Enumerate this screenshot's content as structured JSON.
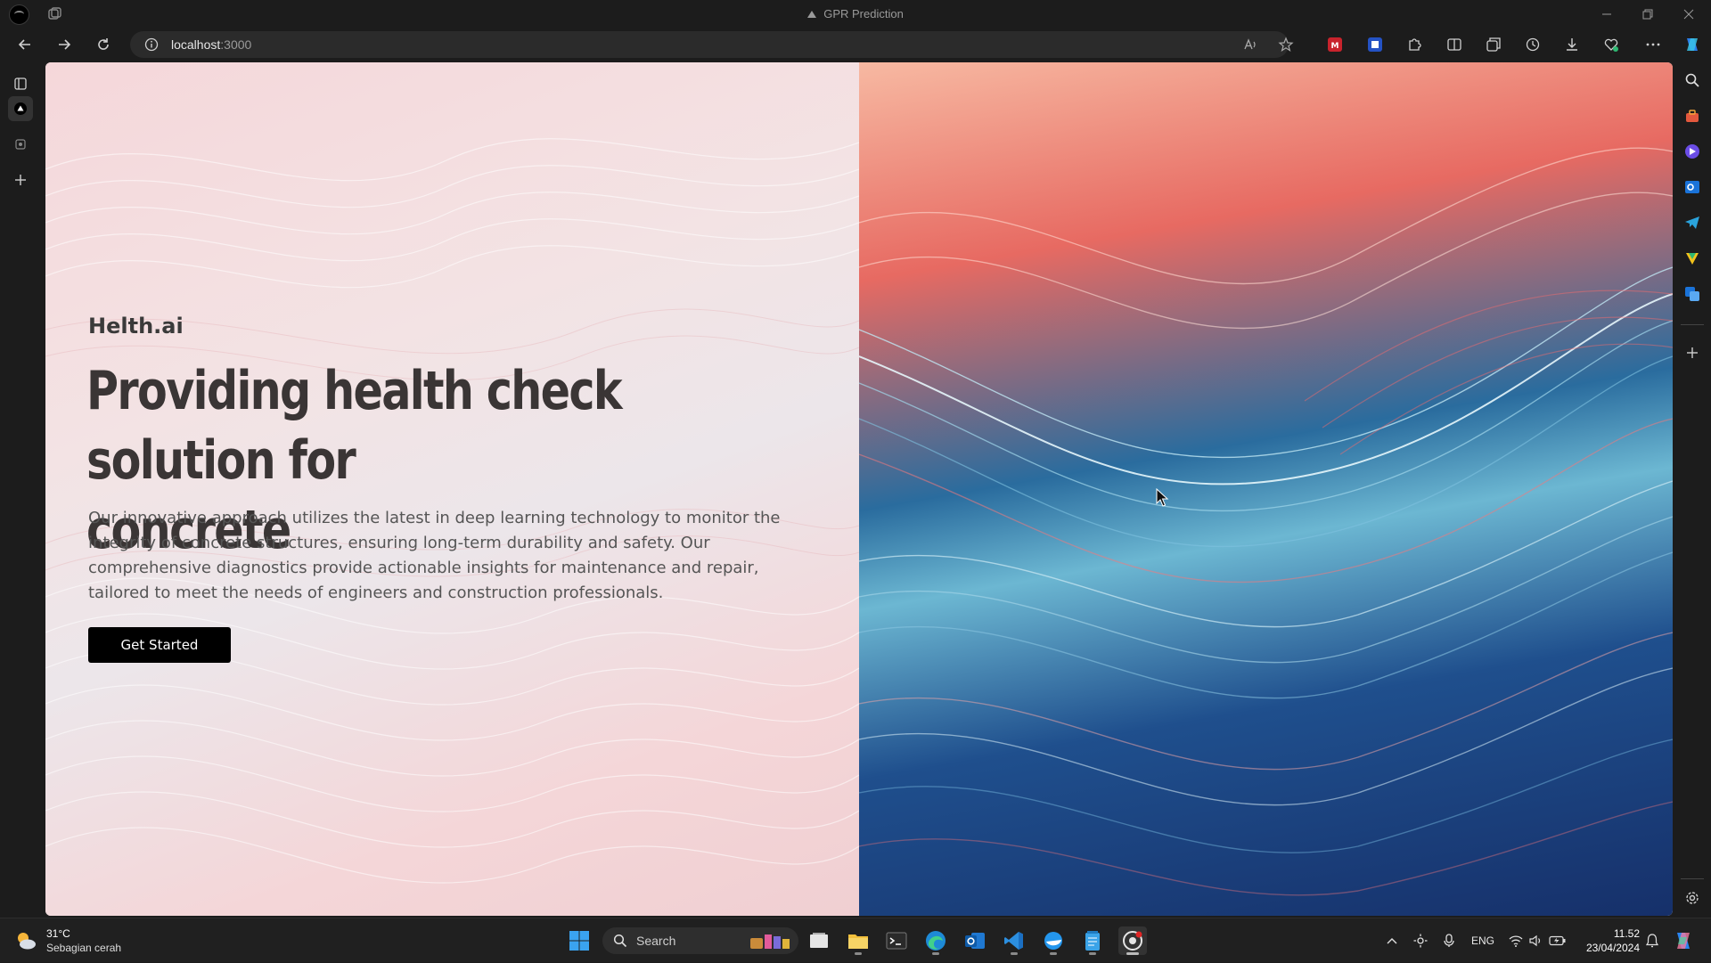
{
  "window": {
    "title": "GPR Prediction"
  },
  "addressbar": {
    "host": "localhost",
    "port": ":3000"
  },
  "page": {
    "brand": "Helth.ai",
    "headline_line1": "Providing health check solution for",
    "headline_line2": "concrete",
    "description": "Our innovative approach utilizes the latest in deep learning technology to monitor the integrity of concrete structures, ensuring long-term durability and safety. Our comprehensive diagnostics provide actionable insights for maintenance and repair, tailored to meet the needs of engineers and construction professionals.",
    "cta_label": "Get Started"
  },
  "taskbar": {
    "weather_temp": "31°C",
    "weather_desc": "Sebagian cerah",
    "search_label": "Search",
    "language": "ENG",
    "time": "11.52",
    "date": "23/04/2024"
  },
  "colors": {
    "chrome_bg": "#1c1c1c",
    "address_bg": "#2b2b2b",
    "taskbar_bg": "#202020",
    "headline": "#3a3535",
    "button_bg": "#000000",
    "button_text": "#ffffff"
  },
  "icons": {
    "titlebar": [
      "profile-icon",
      "tab-actions-icon",
      "minimize-icon",
      "restore-icon",
      "close-icon"
    ],
    "toolbar": [
      "back-icon",
      "forward-icon",
      "refresh-icon",
      "info-icon",
      "read-aloud-icon",
      "favorite-star-icon",
      "extension-red-icon",
      "extension-shield-icon",
      "extensions-puzzle-icon",
      "split-screen-icon",
      "collections-icon",
      "history-icon",
      "downloads-icon",
      "performance-icon",
      "more-icon",
      "copilot-icon"
    ],
    "rightbar": [
      "search-icon",
      "tools-icon",
      "games-icon",
      "outlook-icon",
      "telegram-icon",
      "shopping-icon",
      "translator-icon",
      "add-icon",
      "settings-icon"
    ]
  }
}
